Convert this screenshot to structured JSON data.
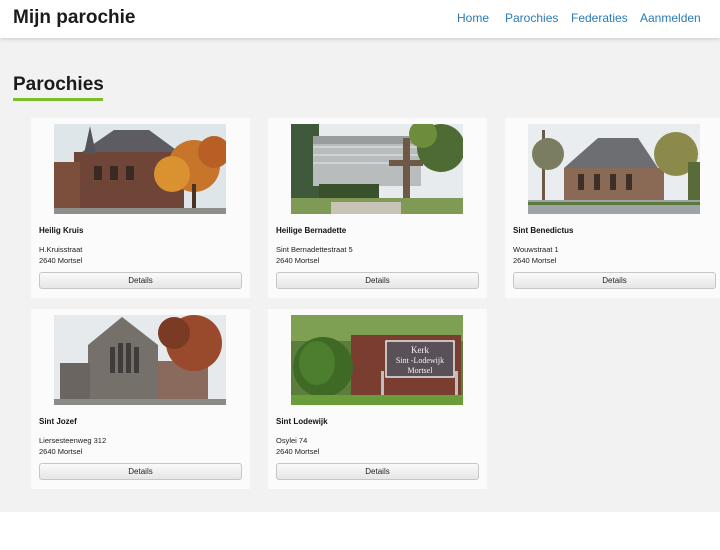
{
  "header": {
    "brand": "Mijn parochie",
    "nav": [
      "Home",
      "Parochies",
      "Federaties",
      "Aanmelden"
    ]
  },
  "page": {
    "title": "Parochies"
  },
  "details_label": "Details",
  "kerk_sign": [
    "Kerk",
    "Sint -Lodewijk",
    "Mortsel"
  ],
  "parishes": [
    {
      "name": "Heilig Kruis",
      "street": "H.Kruisstraat",
      "city": "2640 Mortsel"
    },
    {
      "name": "Heilige Bernadette",
      "street": "Sint Bernadettestraat 5",
      "city": "2640 Mortsel"
    },
    {
      "name": "Sint Benedictus",
      "street": "Wouwstraat 1",
      "city": "2640 Mortsel"
    },
    {
      "name": "Sint Jozef",
      "street": "Liersesteenweg 312",
      "city": "2640 Mortsel"
    },
    {
      "name": "Sint Lodewijk",
      "street": "Osylei 74",
      "city": "2640 Mortsel"
    }
  ]
}
